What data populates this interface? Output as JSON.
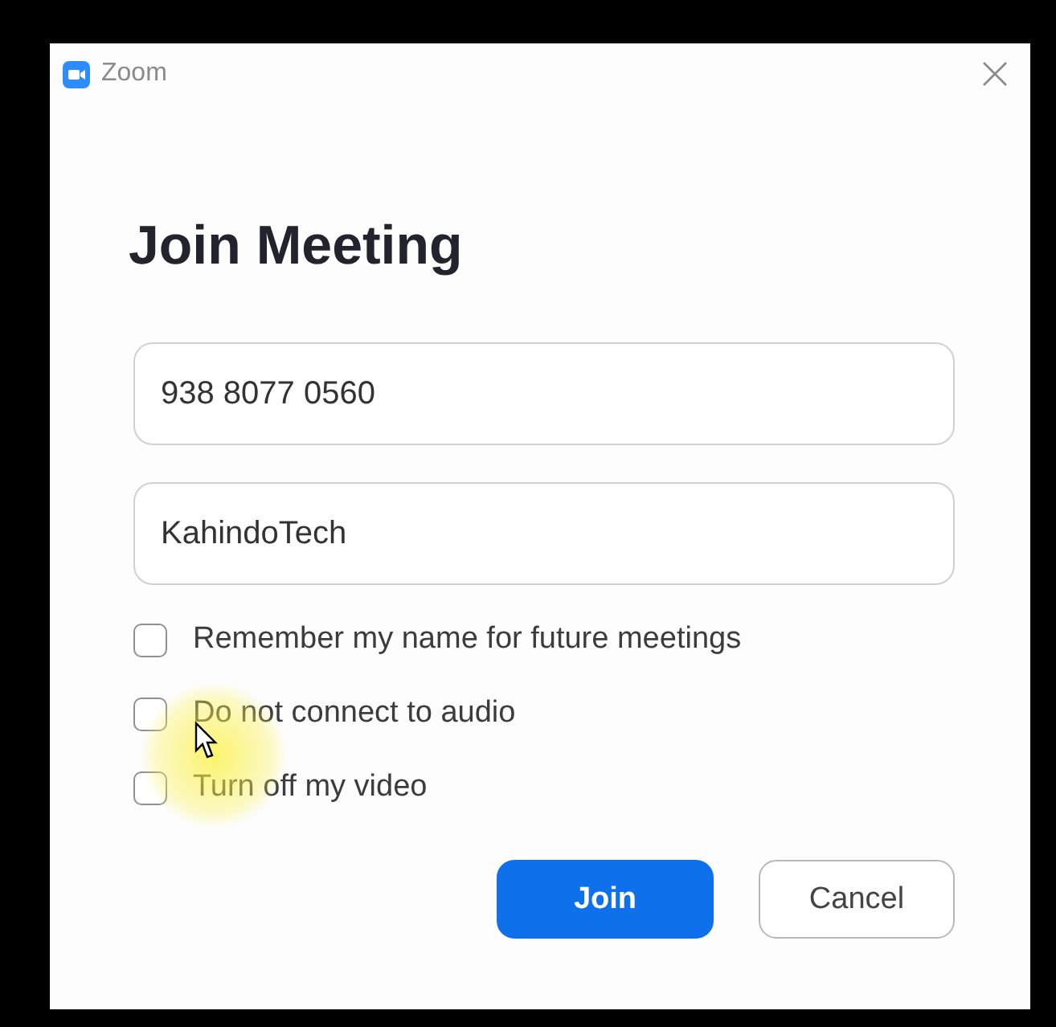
{
  "window": {
    "title": "Zoom"
  },
  "heading": "Join Meeting",
  "fields": [
    {
      "value": "938 8077 0560"
    },
    {
      "value": "KahindoTech"
    }
  ],
  "options": [
    {
      "label": "Remember my name for future meetings",
      "checked": false
    },
    {
      "label": "Do not connect to audio",
      "checked": false
    },
    {
      "label": "Turn off my video",
      "checked": false
    }
  ],
  "buttons": [
    {
      "label": "Join",
      "kind": "primary"
    },
    {
      "label": "Cancel",
      "kind": "secondary"
    }
  ]
}
